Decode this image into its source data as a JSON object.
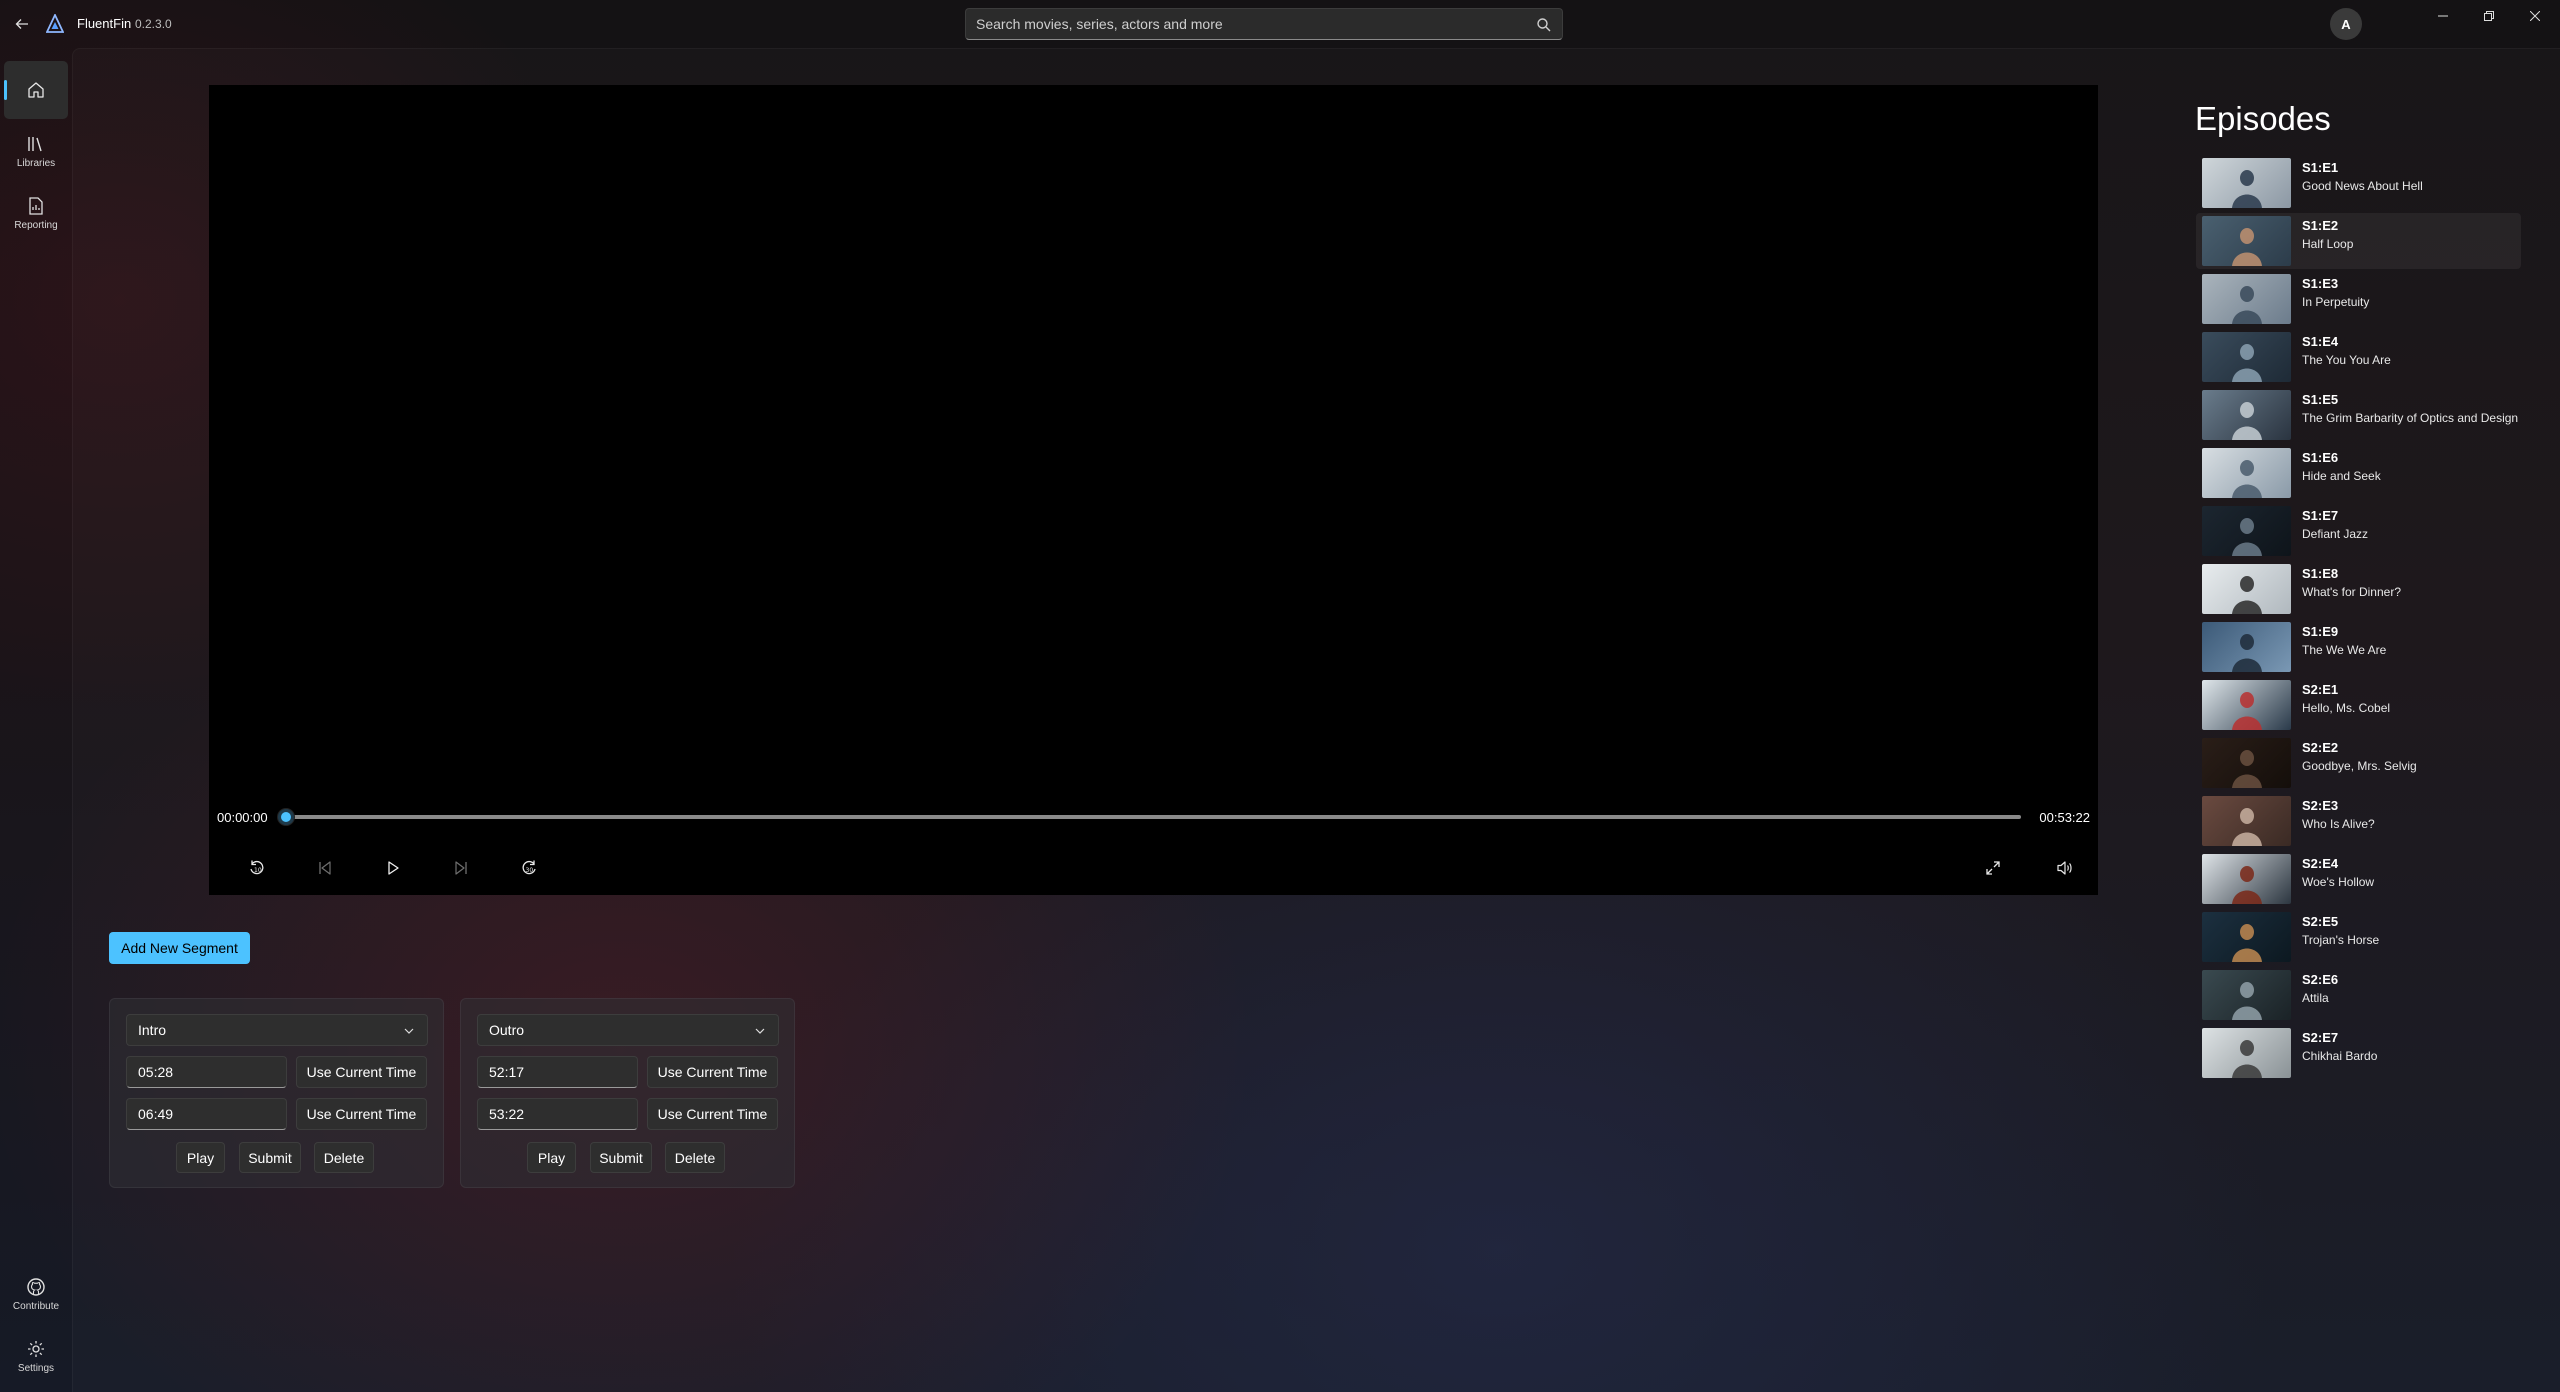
{
  "app": {
    "name": "FluentFin",
    "version": "0.2.3.0",
    "user_initial": "A"
  },
  "search": {
    "placeholder": "Search movies, series, actors and more"
  },
  "nav": {
    "items": [
      {
        "label": "",
        "icon": "home-icon"
      },
      {
        "label": "Libraries",
        "icon": "libraries-icon"
      },
      {
        "label": "Reporting",
        "icon": "reporting-icon"
      }
    ],
    "footer": [
      {
        "label": "Contribute",
        "icon": "github-icon"
      },
      {
        "label": "Settings",
        "icon": "gear-icon"
      }
    ]
  },
  "player": {
    "current_time": "00:00:00",
    "total_time": "00:53:22",
    "progress": 0.0
  },
  "segments": {
    "add_label": "Add New Segment",
    "cards": [
      {
        "type": "Intro",
        "start": "05:28",
        "end": "06:49"
      },
      {
        "type": "Outro",
        "start": "52:17",
        "end": "53:22"
      }
    ],
    "use_current_label": "Use Current Time",
    "play_label": "Play",
    "submit_label": "Submit",
    "delete_label": "Delete"
  },
  "episodes": {
    "title": "Episodes",
    "items": [
      {
        "code": "S1:E1",
        "name": "Good News About Hell"
      },
      {
        "code": "S1:E2",
        "name": "Half Loop"
      },
      {
        "code": "S1:E3",
        "name": "In Perpetuity"
      },
      {
        "code": "S1:E4",
        "name": "The You You Are"
      },
      {
        "code": "S1:E5",
        "name": "The Grim Barbarity of Optics and Design"
      },
      {
        "code": "S1:E6",
        "name": "Hide and Seek"
      },
      {
        "code": "S1:E7",
        "name": "Defiant Jazz"
      },
      {
        "code": "S1:E8",
        "name": "What's for Dinner?"
      },
      {
        "code": "S1:E9",
        "name": "The We We Are"
      },
      {
        "code": "S2:E1",
        "name": "Hello, Ms. Cobel"
      },
      {
        "code": "S2:E2",
        "name": "Goodbye, Mrs. Selvig"
      },
      {
        "code": "S2:E3",
        "name": "Who Is Alive?"
      },
      {
        "code": "S2:E4",
        "name": "Woe's Hollow"
      },
      {
        "code": "S2:E5",
        "name": "Trojan's Horse"
      },
      {
        "code": "S2:E6",
        "name": "Attila"
      },
      {
        "code": "S2:E7",
        "name": "Chikhai Bardo"
      }
    ]
  },
  "colors": {
    "accent": "#4cc2ff"
  }
}
